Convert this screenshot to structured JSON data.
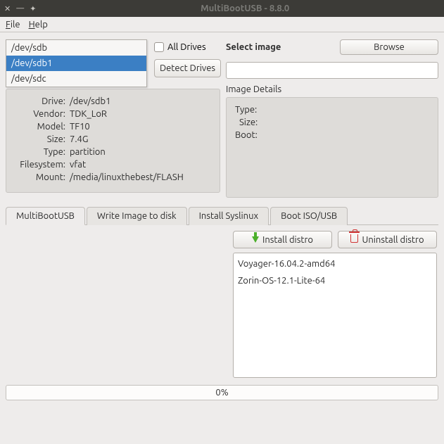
{
  "window": {
    "title": "MultiBootUSB - 8.8.0"
  },
  "menubar": {
    "file": "File",
    "help": "Help"
  },
  "drives": {
    "options": [
      "/dev/sdb",
      "/dev/sdb1",
      "/dev/sdc"
    ],
    "selected_index": 1,
    "all_drives_label": "All Drives",
    "detect_label": "Detect Drives"
  },
  "details": {
    "drive_label": "Drive:",
    "drive_value": "/dev/sdb1",
    "vendor_label": "Vendor:",
    "vendor_value": "TDK_LoR",
    "model_label": "Model:",
    "model_value": "TF10",
    "size_label": "Size:",
    "size_value": "7.4G",
    "type_label": "Type:",
    "type_value": "partition",
    "filesystem_label": "Filesystem:",
    "filesystem_value": "vfat",
    "mount_label": "Mount:",
    "mount_value": "/media/linuxthebest/FLASH"
  },
  "select_image": {
    "title": "Select image",
    "browse_label": "Browse",
    "details_title": "Image Details",
    "type_label": "Type:",
    "size_label": "Size:",
    "boot_label": "Boot:"
  },
  "tabs": {
    "t0": "MultiBootUSB",
    "t1": "Write Image to disk",
    "t2": "Install Syslinux",
    "t3": "Boot ISO/USB"
  },
  "actions": {
    "install_label": "Install distro",
    "uninstall_label": "Uninstall distro"
  },
  "distros": {
    "d0": "Voyager-16.04.2-amd64",
    "d1": "Zorin-OS-12.1-Lite-64"
  },
  "progress": {
    "text": "0%"
  }
}
